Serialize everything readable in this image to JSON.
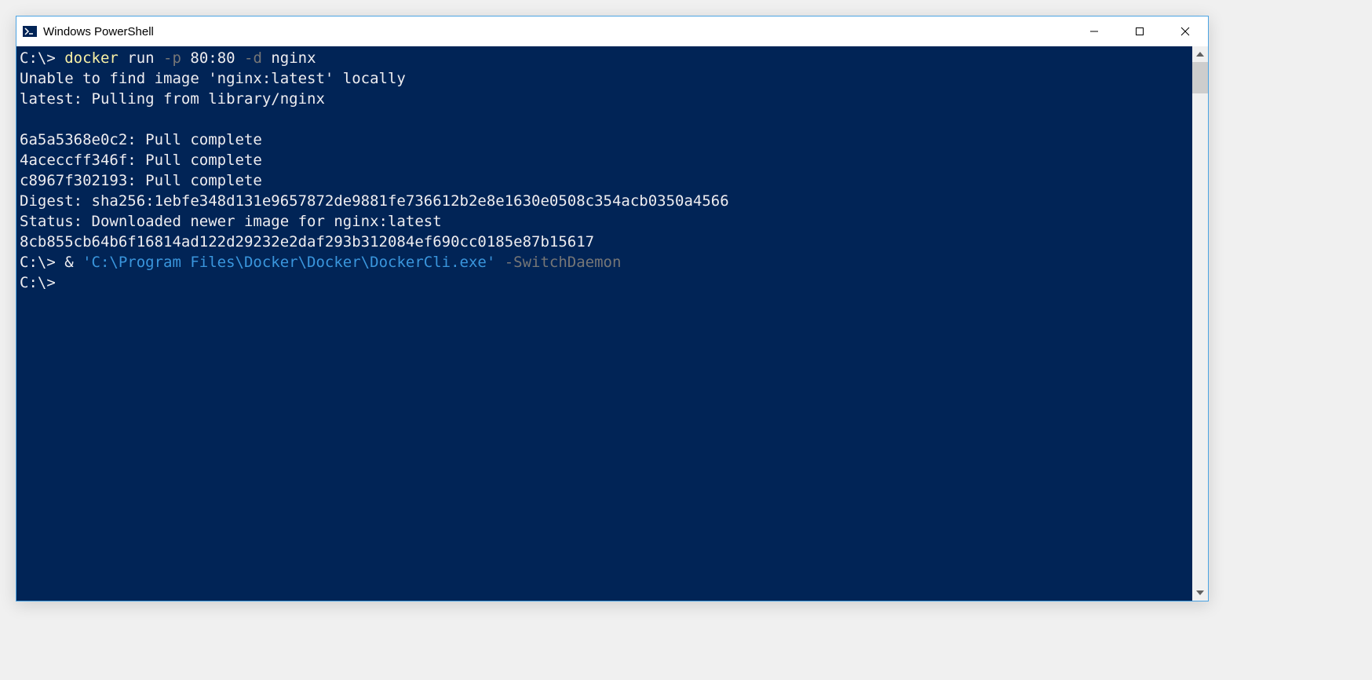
{
  "window": {
    "title": "Windows PowerShell"
  },
  "terminal": {
    "lines": [
      {
        "segments": [
          {
            "text": "C:\\> ",
            "class": ""
          },
          {
            "text": "docker ",
            "class": "t-yellow"
          },
          {
            "text": "run ",
            "class": ""
          },
          {
            "text": "-p ",
            "class": "t-gray"
          },
          {
            "text": "80:80 ",
            "class": ""
          },
          {
            "text": "-d ",
            "class": "t-gray"
          },
          {
            "text": "nginx",
            "class": ""
          }
        ]
      },
      {
        "segments": [
          {
            "text": "Unable to find image 'nginx:latest' locally",
            "class": ""
          }
        ]
      },
      {
        "segments": [
          {
            "text": "latest: Pulling from library/nginx",
            "class": ""
          }
        ]
      },
      {
        "segments": [
          {
            "text": "",
            "class": ""
          }
        ]
      },
      {
        "segments": [
          {
            "text": "6a5a5368e0c2: Pull complete",
            "class": ""
          }
        ]
      },
      {
        "segments": [
          {
            "text": "4aceccff346f: Pull complete",
            "class": ""
          }
        ]
      },
      {
        "segments": [
          {
            "text": "c8967f302193: Pull complete",
            "class": ""
          }
        ]
      },
      {
        "segments": [
          {
            "text": "Digest: sha256:1ebfe348d131e9657872de9881fe736612b2e8e1630e0508c354acb0350a4566",
            "class": ""
          }
        ]
      },
      {
        "segments": [
          {
            "text": "Status: Downloaded newer image for nginx:latest",
            "class": ""
          }
        ]
      },
      {
        "segments": [
          {
            "text": "8cb855cb64b6f16814ad122d29232e2daf293b312084ef690cc0185e87b15617",
            "class": ""
          }
        ]
      },
      {
        "segments": [
          {
            "text": "C:\\> & ",
            "class": ""
          },
          {
            "text": "'C:\\Program Files\\Docker\\Docker\\DockerCli.exe'",
            "class": "t-darkcyan"
          },
          {
            "text": " -SwitchDaemon",
            "class": "t-gray"
          }
        ]
      },
      {
        "segments": [
          {
            "text": "C:\\>",
            "class": ""
          }
        ]
      }
    ]
  }
}
